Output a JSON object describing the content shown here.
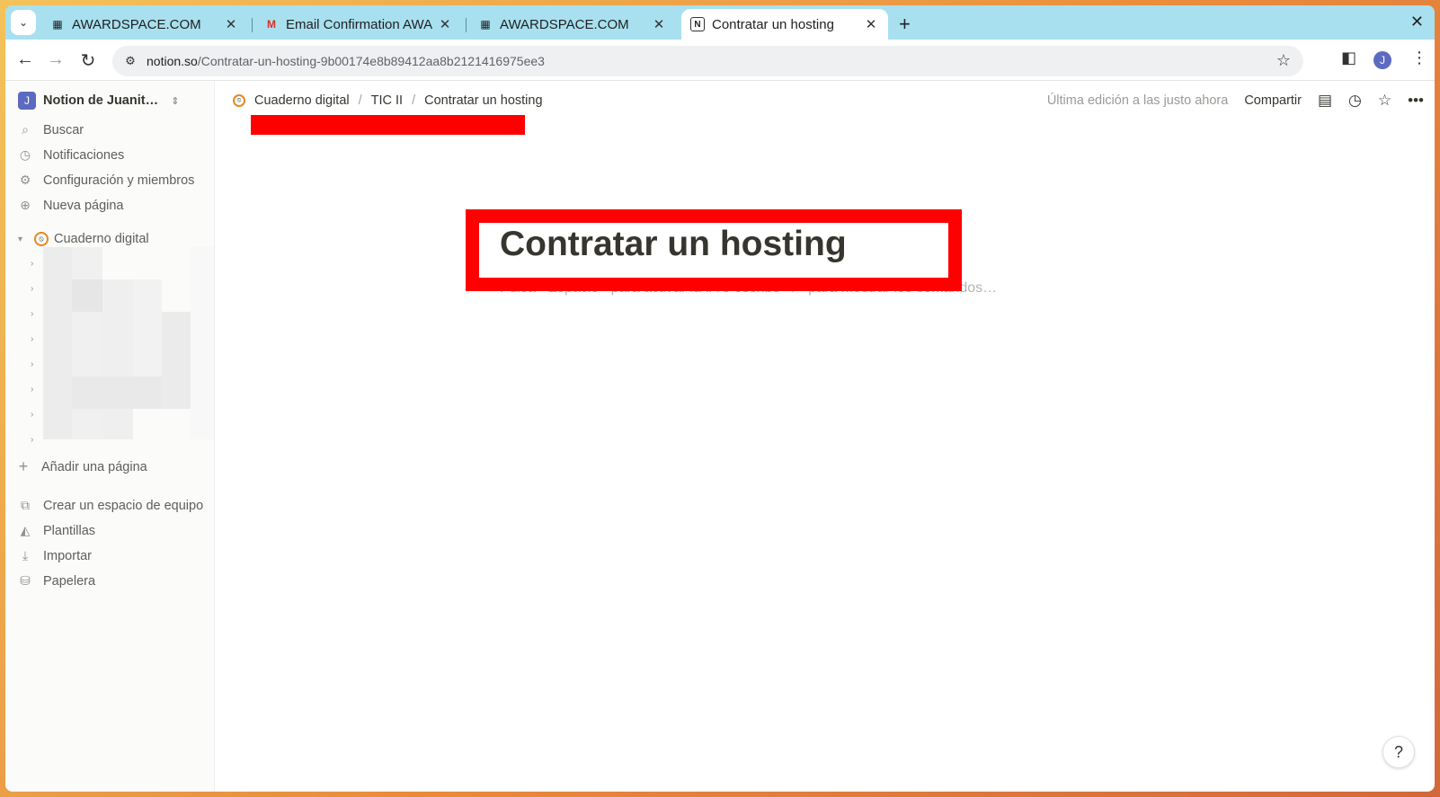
{
  "browser": {
    "tabs": [
      {
        "title": "AWARDSPACE.COM",
        "favicon": "page-icon",
        "active": false
      },
      {
        "title": "Email Confirmation AWA",
        "favicon": "gmail-icon",
        "active": false
      },
      {
        "title": "AWARDSPACE.COM",
        "favicon": "page-icon",
        "active": false
      },
      {
        "title": "Contratar un hosting",
        "favicon": "notion-icon",
        "active": true
      }
    ],
    "url_host": "notion.so",
    "url_path": "/Contratar-un-hosting-9b00174e8b89412aa8b2121416975ee3",
    "profile_initial": "J"
  },
  "sidebar": {
    "workspace_initial": "J",
    "workspace_name": "Notion de Juanit…",
    "items": [
      {
        "label": "Buscar",
        "icon": "search-icon"
      },
      {
        "label": "Notificaciones",
        "icon": "clock-icon"
      },
      {
        "label": "Configuración y miembros",
        "icon": "gear-icon"
      },
      {
        "label": "Nueva página",
        "icon": "plus-circle-icon"
      }
    ],
    "teamspace": "Cuaderno digital",
    "add_page": "Añadir una página",
    "bottom_items": [
      {
        "label": "Crear un espacio de equipo",
        "icon": "team-icon"
      },
      {
        "label": "Plantillas",
        "icon": "shapes-icon"
      },
      {
        "label": "Importar",
        "icon": "download-icon"
      },
      {
        "label": "Papelera",
        "icon": "trash-icon"
      }
    ]
  },
  "main": {
    "breadcrumb": [
      "Cuaderno digital",
      "TIC II",
      "Contratar un hosting"
    ],
    "last_edited": "Última edición a las justo ahora",
    "share_label": "Compartir",
    "page_title": "Contratar un hosting",
    "placeholder": "Pulsa «Espacio» para activar la IA o escribe «/» para mostrar los comandos…",
    "help_label": "?"
  },
  "colors": {
    "tabstrip": "#a8e0ef",
    "highlight_red": "#ff0000",
    "avatar": "#5c6bc0"
  }
}
